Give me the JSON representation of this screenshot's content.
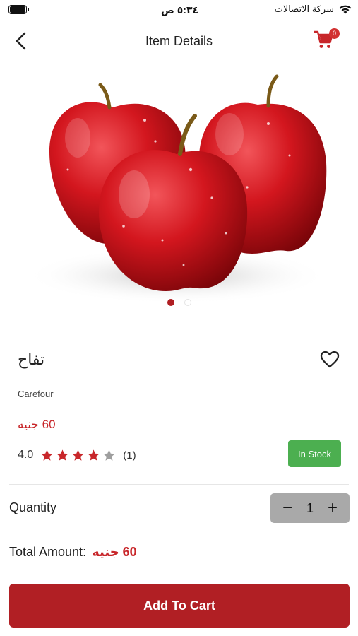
{
  "status_bar": {
    "time": "٥:٣٤ ص",
    "carrier": "شركة الاتصالات"
  },
  "nav": {
    "title": "Item Details",
    "cart_count": "0"
  },
  "product": {
    "name": "تفاح",
    "brand": "Carefour",
    "price": "60 جنيه",
    "rating_value": "4.0",
    "rating_stars": 4,
    "rating_max": 5,
    "rating_count": "(1)",
    "stock_status": "In Stock",
    "image_slide_active": 1,
    "image_slide_total": 2
  },
  "quantity": {
    "label": "Quantity",
    "value": "1",
    "minus": "−",
    "plus": "+"
  },
  "total": {
    "label": "Total Amount:",
    "value": "60 جنيه"
  },
  "actions": {
    "add_to_cart": "Add To Cart"
  },
  "colors": {
    "accent": "#b11f24",
    "price": "#c8262a",
    "in_stock": "#4caf50",
    "star_filled": "#c8262a",
    "star_empty": "#9e9e9e"
  }
}
